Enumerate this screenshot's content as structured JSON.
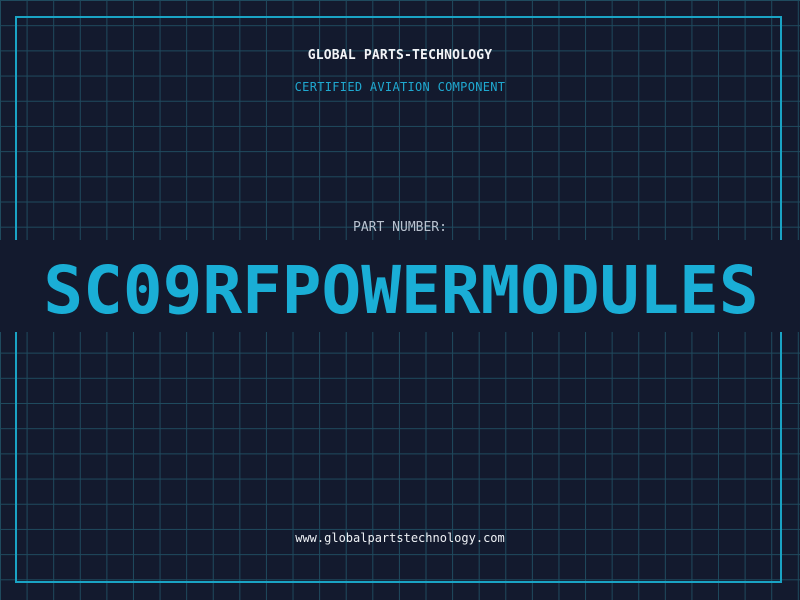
{
  "header": {
    "company_name": "GLOBAL PARTS-TECHNOLOGY",
    "subtitle": "CERTIFIED AVIATION COMPONENT"
  },
  "part": {
    "label": "PART NUMBER:",
    "number": "SC09RFPOWERMODULES"
  },
  "footer": {
    "url": "www.globalpartstechnology.com"
  },
  "colors": {
    "background": "#131a2e",
    "grid": "#1f4a5e",
    "accent": "#1aaed6",
    "frame": "#1aa3c4"
  }
}
